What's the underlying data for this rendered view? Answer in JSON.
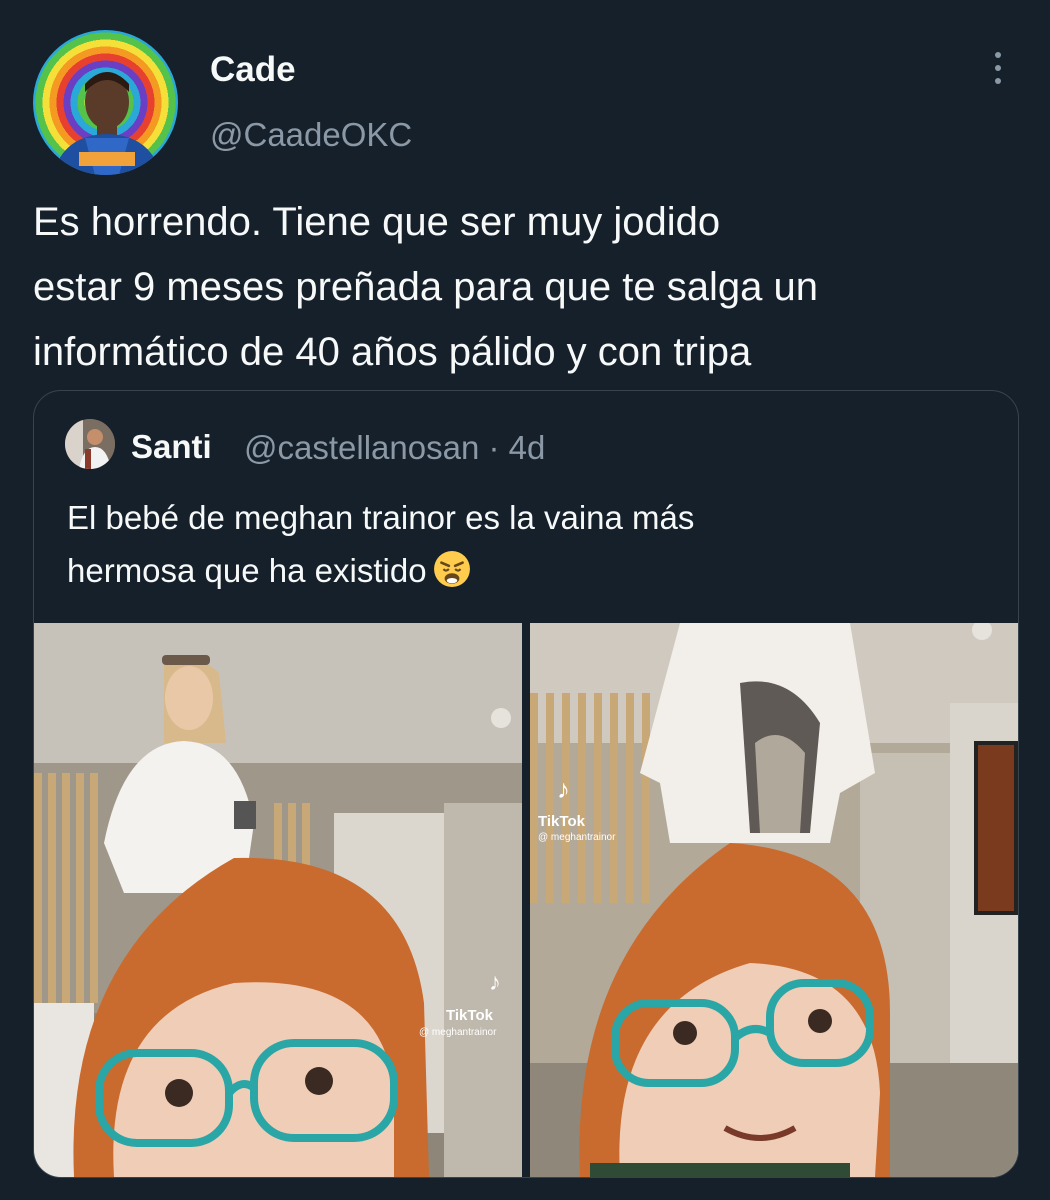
{
  "tweet": {
    "author": {
      "display_name": "Cade",
      "handle": "@CaadeOKC",
      "avatar_icon": "avatar-image"
    },
    "more_icon": "more-vertical-icon",
    "text_lines": [
      "Es horrendo. Tiene que ser muy jodido",
      "estar 9 meses preñada para que te salga un",
      "informático de 40 años pálido y con tripa"
    ]
  },
  "quoted_tweet": {
    "author": {
      "display_name": "Santi",
      "handle": "@castellanosan · 4d"
    },
    "text_lines": [
      "El bebé de meghan trainor es la vaina más",
      "hermosa que ha existido"
    ],
    "emoji": "weary-face-emoji",
    "media": [
      {
        "description_icon": "video-frame-image",
        "watermark_brand": "TikTok",
        "watermark_user": "@ meghantrainor"
      },
      {
        "description_icon": "video-frame-image",
        "watermark_brand": "TikTok",
        "watermark_user": "@ meghantrainor"
      }
    ]
  },
  "colors": {
    "background": "#15202b",
    "primary_text": "#f7f9f9",
    "secondary_text": "#8b98a5",
    "border": "#38444d"
  }
}
